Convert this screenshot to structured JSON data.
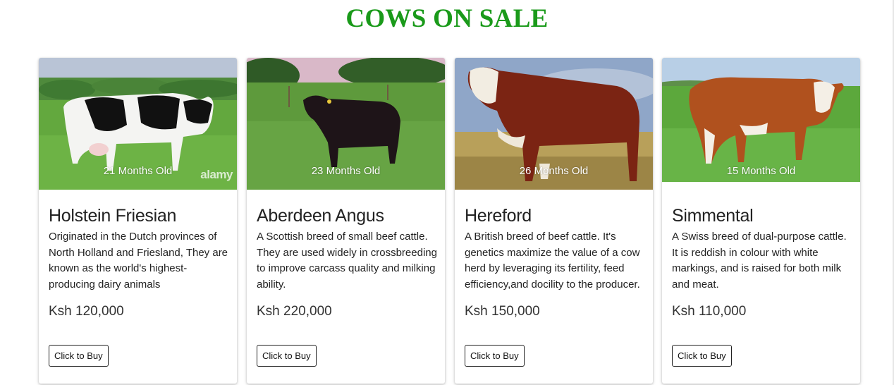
{
  "page": {
    "title": "COWS ON SALE"
  },
  "accent_color": "#1a9a1a",
  "cards": [
    {
      "age": "21 Months Old",
      "watermark": "alamy",
      "breed": "Holstein Friesian",
      "description": "Originated in the Dutch provinces of North Holland and Friesland, They are known as the world's highest-producing dairy animals",
      "price": "Ksh 120,000",
      "button": "Click to Buy",
      "image_icon": "holstein-cow-photo"
    },
    {
      "age": "23 Months Old",
      "breed": "Aberdeen Angus",
      "description": "A Scottish breed of small beef cattle. They are used widely in crossbreeding to improve carcass quality and milking ability.",
      "price": "Ksh 220,000",
      "button": "Click to Buy",
      "image_icon": "angus-cow-photo"
    },
    {
      "age": "26 Months Old",
      "breed": "Hereford",
      "description": "A British breed of beef cattle. It's genetics maximize the value of a cow herd by leveraging its fertility, feed efficiency,and docility to the producer.",
      "price": "Ksh 150,000",
      "button": "Click to Buy",
      "image_icon": "hereford-bull-photo"
    },
    {
      "age": "15 Months Old",
      "breed": "Simmental",
      "description": "A Swiss breed of dual-purpose cattle. It is reddish in colour with white markings, and is raised for both milk and meat.",
      "price": "Ksh 110,000",
      "button": "Click to Buy",
      "image_icon": "simmental-cow-photo"
    }
  ]
}
